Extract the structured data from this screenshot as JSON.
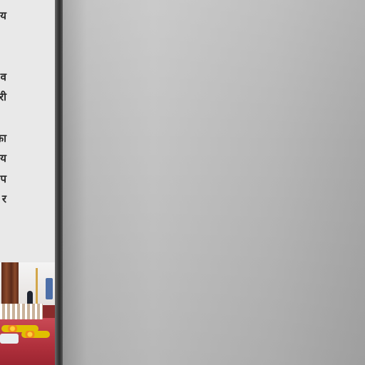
{
  "left_panel": {
    "lines": [
      {
        "text": "य"
      },
      {
        "text": "व"
      },
      {
        "text": "री"
      },
      {
        "text": "का"
      },
      {
        "text": "य"
      },
      {
        "text": "प"
      },
      {
        "text": "र"
      }
    ]
  },
  "photo": {
    "alt_semantic": "temple-interior-photo"
  },
  "colors": {
    "panel_bg": "#e9e9e9",
    "divider": "#2d2d2d",
    "main_bg": "#bdbdbd"
  }
}
